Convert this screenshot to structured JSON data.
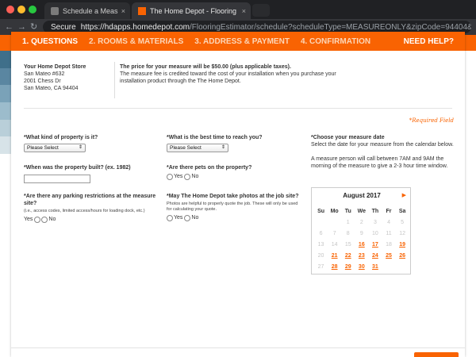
{
  "browser": {
    "tabs": [
      {
        "title": "Schedule a Measure",
        "close": "×"
      },
      {
        "title": "The Home Depot - Flooring Estimator",
        "close": "×"
      }
    ],
    "secure_label": "Secure",
    "url_host": "https://hdapps.homedepot.com",
    "url_path": "/FlooringEstimator/schedule?scheduleType=MEASUREONLY&zipCode=94404&leadSource=#no-..."
  },
  "steps": [
    {
      "label": "1. QUESTIONS",
      "active": true
    },
    {
      "label": "2. ROOMS & MATERIALS",
      "active": false
    },
    {
      "label": "3. ADDRESS & PAYMENT",
      "active": false
    },
    {
      "label": "4. CONFIRMATION",
      "active": false
    }
  ],
  "need_help": "NEED HELP?",
  "store": {
    "title": "Your Home Depot Store",
    "name": "San Mateo #632",
    "street": "2001 Chess Dr",
    "city": "San Mateo, CA 94404"
  },
  "price": {
    "title": "The price for your measure will be $50.00 (plus applicable taxes).",
    "line1": "The measure fee is credited toward the cost of your installation when you purchase your",
    "line2": "installation product through the The Home Depot."
  },
  "required_note": "*Required Field",
  "questions": {
    "property_kind": {
      "label": "*What kind of property is it?",
      "value": "Please Select"
    },
    "best_time": {
      "label": "*What is the best time to reach you?",
      "value": "Please Select"
    },
    "year_built": {
      "label": "*When was the property built? (ex. 1982)",
      "value": ""
    },
    "pets": {
      "label": "*Are there pets on the property?",
      "yes": "Yes",
      "no": "No"
    },
    "parking": {
      "label_line1": "*Are there any parking restrictions at the measure",
      "label_line2": "site?",
      "note": "(i.e., access codes, limited access/hours for loading dock, etc.)",
      "yes": "Yes",
      "no": "No"
    },
    "photos": {
      "label": "*May The Home Depot take photos at the job site?",
      "note_line1": "Photos are helpful to properly quote the job. These will only be used",
      "note_line2": "for calculating your quote.",
      "yes": "Yes",
      "no": "No"
    }
  },
  "measure_date": {
    "title": "*Choose your measure date",
    "instruction": "Select the date for your measure from the calendar below.",
    "info_line1": "A measure person will call between 7AM and 9AM the",
    "info_line2": "morning of the measure to give a 2-3 hour time window."
  },
  "calendar": {
    "month": "August 2017",
    "next_symbol": "▶",
    "weekdays": [
      "Su",
      "Mo",
      "Tu",
      "We",
      "Th",
      "Fr",
      "Sa"
    ],
    "weeks": [
      [
        {
          "d": ""
        },
        {
          "d": ""
        },
        {
          "d": "1",
          "s": "dis"
        },
        {
          "d": "2",
          "s": "dis"
        },
        {
          "d": "3",
          "s": "dis"
        },
        {
          "d": "4",
          "s": "dis"
        },
        {
          "d": "5",
          "s": "dis"
        }
      ],
      [
        {
          "d": "6",
          "s": "dis"
        },
        {
          "d": "7",
          "s": "dis"
        },
        {
          "d": "8",
          "s": "dis"
        },
        {
          "d": "9",
          "s": "dis"
        },
        {
          "d": "10",
          "s": "dis"
        },
        {
          "d": "11",
          "s": "dis"
        },
        {
          "d": "12",
          "s": "dis"
        }
      ],
      [
        {
          "d": "13",
          "s": "dis"
        },
        {
          "d": "14",
          "s": "dis"
        },
        {
          "d": "15",
          "s": "dis"
        },
        {
          "d": "16",
          "s": "av"
        },
        {
          "d": "17",
          "s": "av"
        },
        {
          "d": "18",
          "s": "dis"
        },
        {
          "d": "19",
          "s": "av"
        }
      ],
      [
        {
          "d": "20",
          "s": "dis"
        },
        {
          "d": "21",
          "s": "av"
        },
        {
          "d": "22",
          "s": "av"
        },
        {
          "d": "23",
          "s": "av"
        },
        {
          "d": "24",
          "s": "av"
        },
        {
          "d": "25",
          "s": "av"
        },
        {
          "d": "26",
          "s": "av"
        }
      ],
      [
        {
          "d": "27",
          "s": "dis"
        },
        {
          "d": "28",
          "s": "av"
        },
        {
          "d": "29",
          "s": "av"
        },
        {
          "d": "30",
          "s": "av"
        },
        {
          "d": "31",
          "s": "av"
        },
        {
          "d": ""
        },
        {
          "d": ""
        }
      ]
    ]
  },
  "colors": {
    "brand_orange": "#f96302",
    "swatches": [
      "#3f6f8a",
      "#5a86a1",
      "#7aa2b8",
      "#9cbccc",
      "#b9cfd9",
      "#d7e3e8"
    ]
  }
}
